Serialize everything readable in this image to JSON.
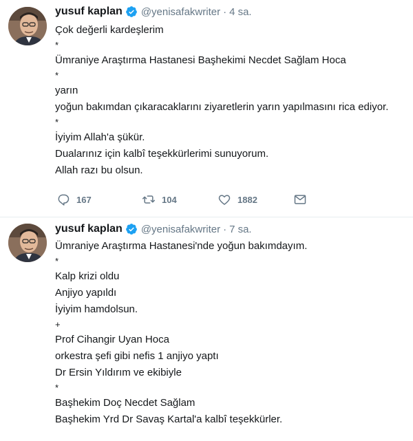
{
  "tweets": [
    {
      "author": {
        "name": "yusuf kaplan",
        "handle": "@yenisafakwriter",
        "verified": true
      },
      "separator": "·",
      "time": "4 sa.",
      "lines": [
        "Çok değerli kardeşlerim",
        "*",
        "Ümraniye Araştırma Hastanesi Başhekimi Necdet Sağlam Hoca",
        "*",
        "yarın",
        "yoğun bakımdan çıkaracaklarını ziyaretlerin yarın yapılmasını rica ediyor.",
        "*",
        "İyiyim Allah'a şükür.",
        "Dualarınız için kalbî teşekkürlerimi sunuyorum.",
        "Allah razı bu olsun."
      ],
      "actions": {
        "replies": "167",
        "retweets": "104",
        "likes": "1882"
      }
    },
    {
      "author": {
        "name": "yusuf kaplan",
        "handle": "@yenisafakwriter",
        "verified": true
      },
      "separator": "·",
      "time": "7 sa.",
      "lines": [
        "Ümraniye Araştırma Hastanesi'nde yoğun bakımdayım.",
        "*",
        "Kalp krizi oldu",
        "Anjiyo yapıldı",
        "İyiyim hamdolsun.",
        "+",
        "Prof Cihangir Uyan Hoca",
        "orkestra şefi gibi nefis 1 anjiyo yaptı",
        "Dr Ersin Yıldırım ve ekibiyle",
        "*",
        "Başhekim Doç Necdet Sağlam",
        "Başhekim Yrd Dr Savaş Kartal'a kalbî teşekkürler."
      ]
    }
  ],
  "icons": {
    "reply": "reply-icon",
    "retweet": "retweet-icon",
    "like": "heart-icon",
    "dm": "mail-icon",
    "verified": "verified-badge-icon"
  },
  "colors": {
    "text": "#14171a",
    "muted": "#657786",
    "verified": "#1da1f2",
    "divider": "#e6ecf0"
  }
}
